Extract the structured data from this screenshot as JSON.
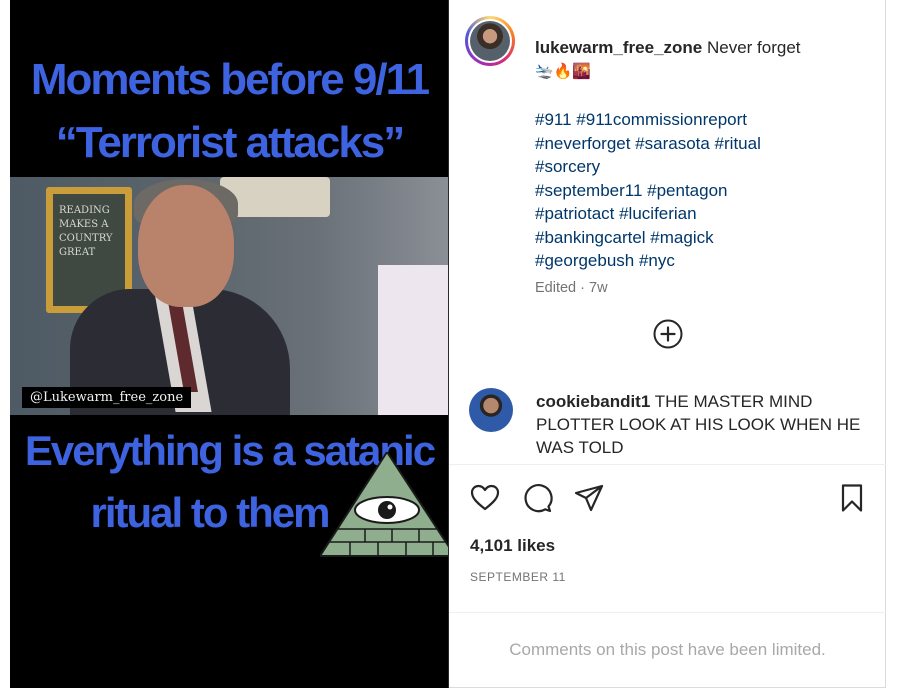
{
  "media": {
    "top_caption_line1": "Moments before 9/11",
    "top_caption_line2": "“Terrorist attacks”",
    "bottom_caption_line1": "Everything is a satanic",
    "bottom_caption_line2": "ritual to them",
    "watermark": "@Lukewarm_free_zone",
    "board_text": "READING MAKES A COUNTRY GREAT",
    "caption_color": "#3d63e0"
  },
  "post": {
    "username": "lukewarm_free_zone",
    "caption": "Never forget",
    "emojis": "🛬🔥🌇",
    "hashtags_lines": [
      "#911 #911commissionreport",
      "#neverforget #sarasota #ritual",
      "#sorcery",
      "#september11 #pentagon",
      "#patriotact #luciferian",
      "#bankingcartel #magick",
      "#georgebush #nyc"
    ],
    "edited_label": "Edited",
    "edited_age": "· 7w",
    "hashtag_color": "#00376b"
  },
  "comment": {
    "username": "cookiebandit1",
    "text": "THE MASTER MIND PLOTTER LOOK AT HIS LOOK WHEN HE WAS TOLD"
  },
  "actions": {
    "like_icon": "heart-icon",
    "comment_icon": "comment-icon",
    "share_icon": "send-icon",
    "save_icon": "bookmark-icon",
    "load_more_icon": "plus-circle-icon"
  },
  "stats": {
    "likes": "4,101 likes",
    "date": "SEPTEMBER 11"
  },
  "footer": {
    "limited": "Comments on this post have been limited."
  }
}
